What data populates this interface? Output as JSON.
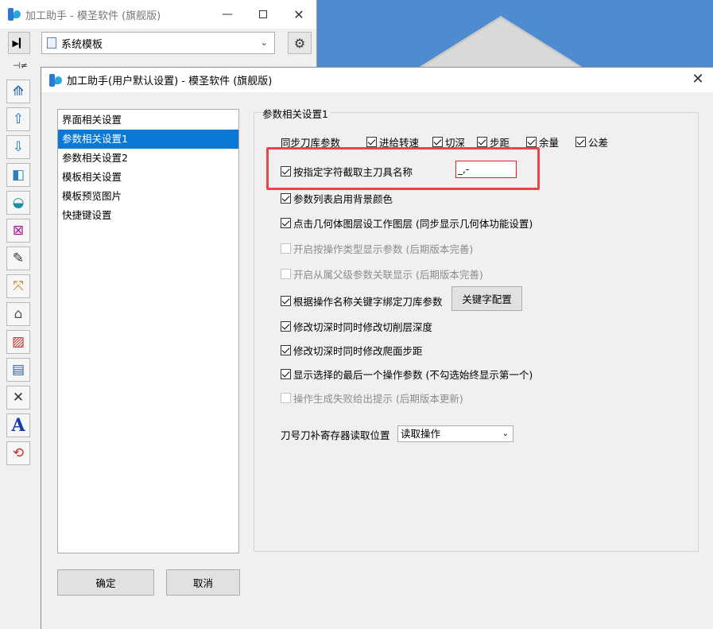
{
  "back_window": {
    "title": "加工助手 - 模圣软件 (旗舰版)",
    "template_select": "系统模板",
    "icons": [
      "play-step-icon",
      "pin-icon",
      "gear-icon"
    ]
  },
  "side_tools": [
    "tool-path-icon",
    "arrow-up-icon",
    "arrow-down-icon",
    "solid-cube-icon",
    "surface-icon",
    "frame-edit-icon",
    "note-edit-icon",
    "transform-icon",
    "tool-holder-icon",
    "measure-icon",
    "layer-tool-icon",
    "delete-tool-icon",
    "text-icon",
    "rotate-part-icon"
  ],
  "text_tool_letter": "A",
  "dialog": {
    "title": "加工助手(用户默认设置) - 模圣软件 (旗舰版)",
    "nav": [
      {
        "label": "界面相关设置",
        "active": false
      },
      {
        "label": "参数相关设置1",
        "active": true
      },
      {
        "label": "参数相关设置2",
        "active": false
      },
      {
        "label": "模板相关设置",
        "active": false
      },
      {
        "label": "模板预览图片",
        "active": false
      },
      {
        "label": "快捷键设置",
        "active": false
      }
    ],
    "ok_label": "确定",
    "cancel_label": "取消",
    "group_title": "参数相关设置1",
    "sync_label": "同步刀库参数",
    "sync_options": [
      {
        "label": "进给转速",
        "checked": true
      },
      {
        "label": "切深",
        "checked": true
      },
      {
        "label": "步距",
        "checked": true
      },
      {
        "label": "余量",
        "checked": true
      },
      {
        "label": "公差",
        "checked": true
      }
    ],
    "options": [
      {
        "label": "按指定字符截取主刀具名称",
        "checked": true,
        "disabled": false
      },
      {
        "label": "参数列表启用背景颜色",
        "checked": true,
        "disabled": false
      },
      {
        "label": "点击几何体图层设工作图层 (同步显示几何体功能设置)",
        "checked": true,
        "disabled": false
      },
      {
        "label": "开启按操作类型显示参数 (后期版本完善)",
        "checked": false,
        "disabled": true
      },
      {
        "label": "开启从属父级参数关联显示 (后期版本完善)",
        "checked": false,
        "disabled": true
      },
      {
        "label": "根据操作名称关键字绑定刀库参数",
        "checked": true,
        "disabled": false
      },
      {
        "label": "修改切深时同时修改切削层深度",
        "checked": true,
        "disabled": false
      },
      {
        "label": "修改切深时同时修改爬面步距",
        "checked": true,
        "disabled": false
      },
      {
        "label": "显示选择的最后一个操作参数 (不勾选始终显示第一个)",
        "checked": true,
        "disabled": false
      },
      {
        "label": "操作生成失败给出提示 (后期版本更新)",
        "checked": false,
        "disabled": true
      }
    ],
    "separator_value": "_,-",
    "keyword_button": "关键字配置",
    "register_label": "刀号刀补寄存器读取位置",
    "register_value": "读取操作",
    "accent_color": "#0a78d7",
    "highlight_color": "#e8464f"
  }
}
